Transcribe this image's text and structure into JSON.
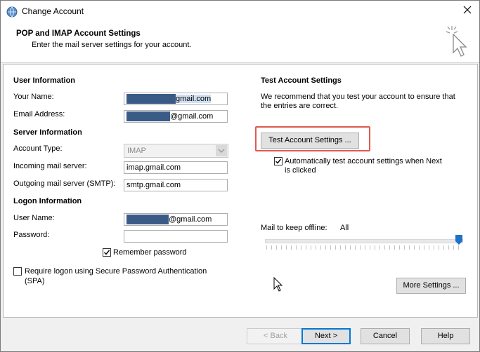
{
  "window": {
    "title": "Change Account",
    "close_icon": "close-icon"
  },
  "header": {
    "title": "POP and IMAP Account Settings",
    "subtitle": "Enter the mail server settings for your account."
  },
  "user_information": {
    "heading": "User Information",
    "your_name_label": "Your Name:",
    "your_name_value": "gmail.com",
    "email_label": "Email Address:",
    "email_value": "@gmail.com"
  },
  "server_information": {
    "heading": "Server Information",
    "account_type_label": "Account Type:",
    "account_type_value": "IMAP",
    "incoming_label": "Incoming mail server:",
    "incoming_value": "imap.gmail.com",
    "outgoing_label": "Outgoing mail server (SMTP):",
    "outgoing_value": "smtp.gmail.com"
  },
  "logon_information": {
    "heading": "Logon Information",
    "username_label": "User Name:",
    "username_value": "@gmail.com",
    "password_label": "Password:",
    "password_value": "",
    "remember_password_label": "Remember password",
    "remember_password_checked": true,
    "spa_label_line1": "Require logon using Secure Password Authentication",
    "spa_label_line2": "(SPA)",
    "spa_checked": false
  },
  "test_settings": {
    "heading": "Test Account Settings",
    "description_line1": "We recommend that you test your account to ensure that",
    "description_line2": "the entries are correct.",
    "test_button": "Test Account Settings ...",
    "auto_test_line1": "Automatically test account settings when Next",
    "auto_test_line2": "is clicked",
    "auto_test_checked": true
  },
  "offline": {
    "label": "Mail to keep offline:",
    "value": "All",
    "slider_level": 1.0
  },
  "more_settings_button": "More Settings ...",
  "footer": {
    "back": "< Back",
    "next": "Next >",
    "cancel": "Cancel",
    "help": "Help"
  },
  "colors": {
    "highlight_border": "#e05a4f",
    "redaction": "#3a5b86",
    "slider_thumb": "#1f72c9",
    "default_button_border": "#0078d7"
  }
}
